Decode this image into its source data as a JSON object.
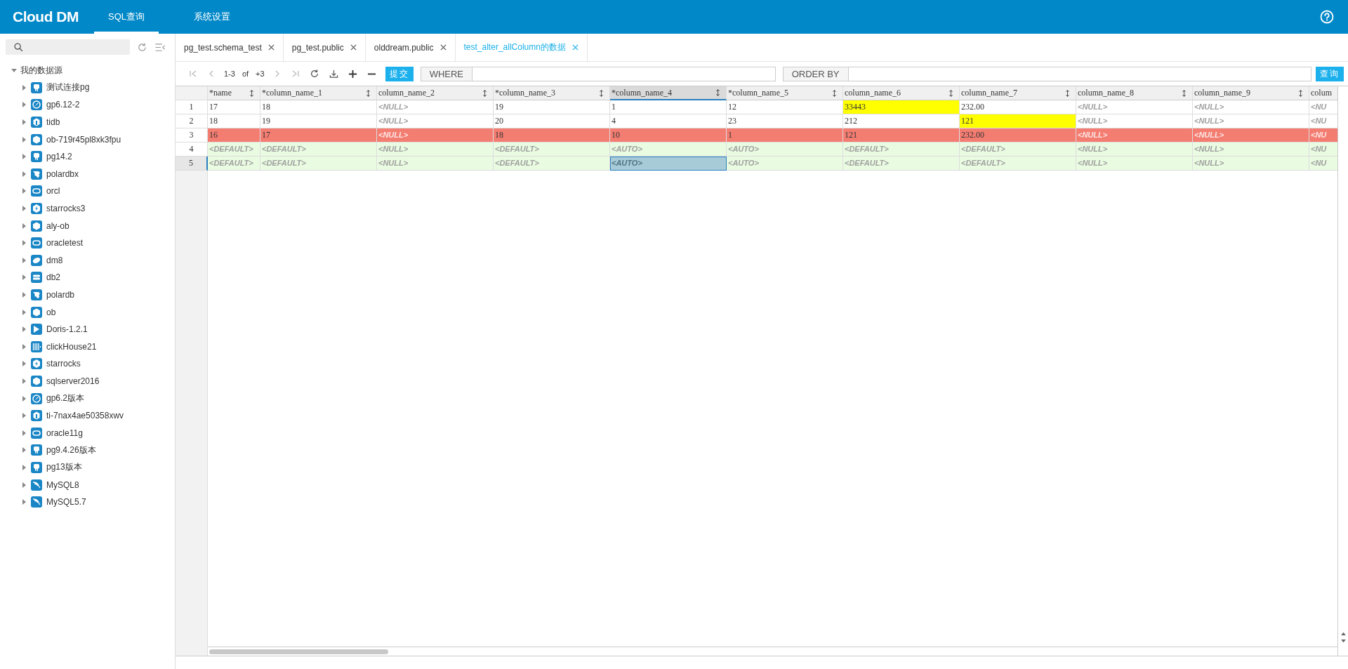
{
  "app": {
    "logo": "Cloud DM",
    "nav": [
      {
        "label": "SQL查询",
        "selected": true
      },
      {
        "label": "系统设置",
        "selected": false
      }
    ]
  },
  "sidebar": {
    "tree": [
      {
        "label": "我的数据源",
        "expanded": true,
        "children": [
          {
            "label": "测试连接pg",
            "kind": "elephant",
            "expanded": false
          },
          {
            "label": "gp6.12-2",
            "kind": "compass",
            "expanded": false
          },
          {
            "label": "tidb",
            "kind": "block",
            "expanded": false
          },
          {
            "label": "ob-719r45pl8xk3fpu",
            "kind": "hexagon",
            "expanded": false
          },
          {
            "label": "pg14.2",
            "kind": "elephant",
            "expanded": false
          },
          {
            "label": "polardbx",
            "kind": "wave",
            "expanded": false
          },
          {
            "label": "orcl",
            "kind": "oval",
            "expanded": false
          },
          {
            "label": "starrocks3",
            "kind": "bolt",
            "expanded": false
          },
          {
            "label": "aly-ob",
            "kind": "hexagon",
            "expanded": false
          },
          {
            "label": "oracletest",
            "kind": "oval",
            "expanded": false
          },
          {
            "label": "dm8",
            "kind": "disc",
            "expanded": false
          },
          {
            "label": "db2",
            "kind": "stack",
            "expanded": false
          },
          {
            "label": "polardb",
            "kind": "wave",
            "expanded": false
          },
          {
            "label": "ob",
            "kind": "hexagon",
            "expanded": false
          },
          {
            "label": "Doris-1.2.1",
            "kind": "flag",
            "expanded": false
          },
          {
            "label": "clickHouse21",
            "kind": "bars",
            "expanded": false
          },
          {
            "label": "starrocks",
            "kind": "bolt",
            "expanded": false
          },
          {
            "label": "sqlserver2016",
            "kind": "cube",
            "expanded": false
          },
          {
            "label": "gp6.2版本",
            "kind": "compass",
            "expanded": false
          },
          {
            "label": "ti-7nax4ae50358xwv",
            "kind": "block",
            "expanded": false
          },
          {
            "label": "oracle11g",
            "kind": "oval",
            "expanded": false
          },
          {
            "label": "pg9.4.26版本",
            "kind": "elephant",
            "expanded": false
          },
          {
            "label": "pg13版本",
            "kind": "elephant",
            "expanded": false
          },
          {
            "label": "MySQL8",
            "kind": "dolphin",
            "expanded": false
          },
          {
            "label": "MySQL5.7",
            "kind": "dolphin",
            "expanded": false
          }
        ]
      }
    ]
  },
  "tabs": [
    {
      "label": "pg_test.schema_test",
      "selected": false
    },
    {
      "label": "pg_test.public",
      "selected": false
    },
    {
      "label": "olddream.public",
      "selected": false
    },
    {
      "label": "test_alter_allColumn的数据",
      "selected": true
    }
  ],
  "toolbar": {
    "range": "1-3",
    "of": "of",
    "total": "+3",
    "submit": "提交",
    "where_label": "WHERE",
    "order_label": "ORDER BY",
    "query": "查询"
  },
  "grid": {
    "columns": [
      {
        "name": "*name",
        "selected": false
      },
      {
        "name": "*column_name_1",
        "selected": false
      },
      {
        "name": "column_name_2",
        "selected": false
      },
      {
        "name": "*column_name_3",
        "selected": false
      },
      {
        "name": "*column_name_4",
        "selected": true
      },
      {
        "name": "*column_name_5",
        "selected": false
      },
      {
        "name": "column_name_6",
        "selected": false
      },
      {
        "name": "column_name_7",
        "selected": false
      },
      {
        "name": "column_name_8",
        "selected": false
      },
      {
        "name": "column_name_9",
        "selected": false
      },
      {
        "name": "colum",
        "selected": false
      }
    ],
    "rows": [
      {
        "num": "1",
        "kind": "normal",
        "selected": false,
        "cells": [
          {
            "text": "17",
            "kind": "value",
            "modified": false,
            "selected": false
          },
          {
            "text": "18",
            "kind": "value",
            "modified": false,
            "selected": false
          },
          {
            "text": "<NULL>",
            "kind": "null",
            "modified": false,
            "selected": false
          },
          {
            "text": "19",
            "kind": "value",
            "modified": false,
            "selected": false
          },
          {
            "text": "1",
            "kind": "value",
            "modified": false,
            "selected": false
          },
          {
            "text": "12",
            "kind": "value",
            "modified": false,
            "selected": false
          },
          {
            "text": "33443",
            "kind": "value",
            "modified": true,
            "selected": false
          },
          {
            "text": "232.00",
            "kind": "value",
            "modified": false,
            "selected": false
          },
          {
            "text": "<NULL>",
            "kind": "null",
            "modified": false,
            "selected": false
          },
          {
            "text": "<NULL>",
            "kind": "null",
            "modified": false,
            "selected": false
          },
          {
            "text": "<NU",
            "kind": "null",
            "modified": false,
            "selected": false
          }
        ]
      },
      {
        "num": "2",
        "kind": "normal",
        "selected": false,
        "cells": [
          {
            "text": "18",
            "kind": "value",
            "modified": false,
            "selected": false
          },
          {
            "text": "19",
            "kind": "value",
            "modified": false,
            "selected": false
          },
          {
            "text": "<NULL>",
            "kind": "null",
            "modified": false,
            "selected": false
          },
          {
            "text": "20",
            "kind": "value",
            "modified": false,
            "selected": false
          },
          {
            "text": "4",
            "kind": "value",
            "modified": false,
            "selected": false
          },
          {
            "text": "23",
            "kind": "value",
            "modified": false,
            "selected": false
          },
          {
            "text": "212",
            "kind": "value",
            "modified": false,
            "selected": false
          },
          {
            "text": "121",
            "kind": "value",
            "modified": true,
            "selected": false
          },
          {
            "text": "<NULL>",
            "kind": "null",
            "modified": false,
            "selected": false
          },
          {
            "text": "<NULL>",
            "kind": "null",
            "modified": false,
            "selected": false
          },
          {
            "text": "<NU",
            "kind": "null",
            "modified": false,
            "selected": false
          }
        ]
      },
      {
        "num": "3",
        "kind": "deleted",
        "selected": false,
        "cells": [
          {
            "text": "16",
            "kind": "value",
            "modified": false,
            "selected": false
          },
          {
            "text": "17",
            "kind": "value",
            "modified": false,
            "selected": false
          },
          {
            "text": "<NULL>",
            "kind": "null",
            "modified": false,
            "selected": false
          },
          {
            "text": "18",
            "kind": "value",
            "modified": false,
            "selected": false
          },
          {
            "text": "10",
            "kind": "value",
            "modified": false,
            "selected": false
          },
          {
            "text": "1",
            "kind": "value",
            "modified": false,
            "selected": false
          },
          {
            "text": "121",
            "kind": "value",
            "modified": false,
            "selected": false
          },
          {
            "text": "232.00",
            "kind": "value",
            "modified": false,
            "selected": false
          },
          {
            "text": "<NULL>",
            "kind": "null",
            "modified": false,
            "selected": false
          },
          {
            "text": "<NULL>",
            "kind": "null",
            "modified": false,
            "selected": false
          },
          {
            "text": "<NU",
            "kind": "null",
            "modified": false,
            "selected": false
          }
        ]
      },
      {
        "num": "4",
        "kind": "new",
        "selected": false,
        "cells": [
          {
            "text": "<DEFAULT>",
            "kind": "default",
            "modified": false,
            "selected": false
          },
          {
            "text": "<DEFAULT>",
            "kind": "default",
            "modified": false,
            "selected": false
          },
          {
            "text": "<NULL>",
            "kind": "null",
            "modified": false,
            "selected": false
          },
          {
            "text": "<DEFAULT>",
            "kind": "default",
            "modified": false,
            "selected": false
          },
          {
            "text": "<AUTO>",
            "kind": "auto",
            "modified": false,
            "selected": false
          },
          {
            "text": "<AUTO>",
            "kind": "auto",
            "modified": false,
            "selected": false
          },
          {
            "text": "<DEFAULT>",
            "kind": "default",
            "modified": false,
            "selected": false
          },
          {
            "text": "<DEFAULT>",
            "kind": "default",
            "modified": false,
            "selected": false
          },
          {
            "text": "<NULL>",
            "kind": "null",
            "modified": false,
            "selected": false
          },
          {
            "text": "<NULL>",
            "kind": "null",
            "modified": false,
            "selected": false
          },
          {
            "text": "<NU",
            "kind": "null",
            "modified": false,
            "selected": false
          }
        ]
      },
      {
        "num": "5",
        "kind": "new",
        "selected": true,
        "cells": [
          {
            "text": "<DEFAULT>",
            "kind": "default",
            "modified": false,
            "selected": false
          },
          {
            "text": "<DEFAULT>",
            "kind": "default",
            "modified": false,
            "selected": false
          },
          {
            "text": "<NULL>",
            "kind": "null",
            "modified": false,
            "selected": false
          },
          {
            "text": "<DEFAULT>",
            "kind": "default",
            "modified": false,
            "selected": false
          },
          {
            "text": "<AUTO>",
            "kind": "auto",
            "modified": false,
            "selected": true
          },
          {
            "text": "<AUTO>",
            "kind": "auto",
            "modified": false,
            "selected": false
          },
          {
            "text": "<DEFAULT>",
            "kind": "default",
            "modified": false,
            "selected": false
          },
          {
            "text": "<DEFAULT>",
            "kind": "default",
            "modified": false,
            "selected": false
          },
          {
            "text": "<NULL>",
            "kind": "null",
            "modified": false,
            "selected": false
          },
          {
            "text": "<NULL>",
            "kind": "null",
            "modified": false,
            "selected": false
          },
          {
            "text": "<NU",
            "kind": "null",
            "modified": false,
            "selected": false
          }
        ]
      }
    ]
  }
}
